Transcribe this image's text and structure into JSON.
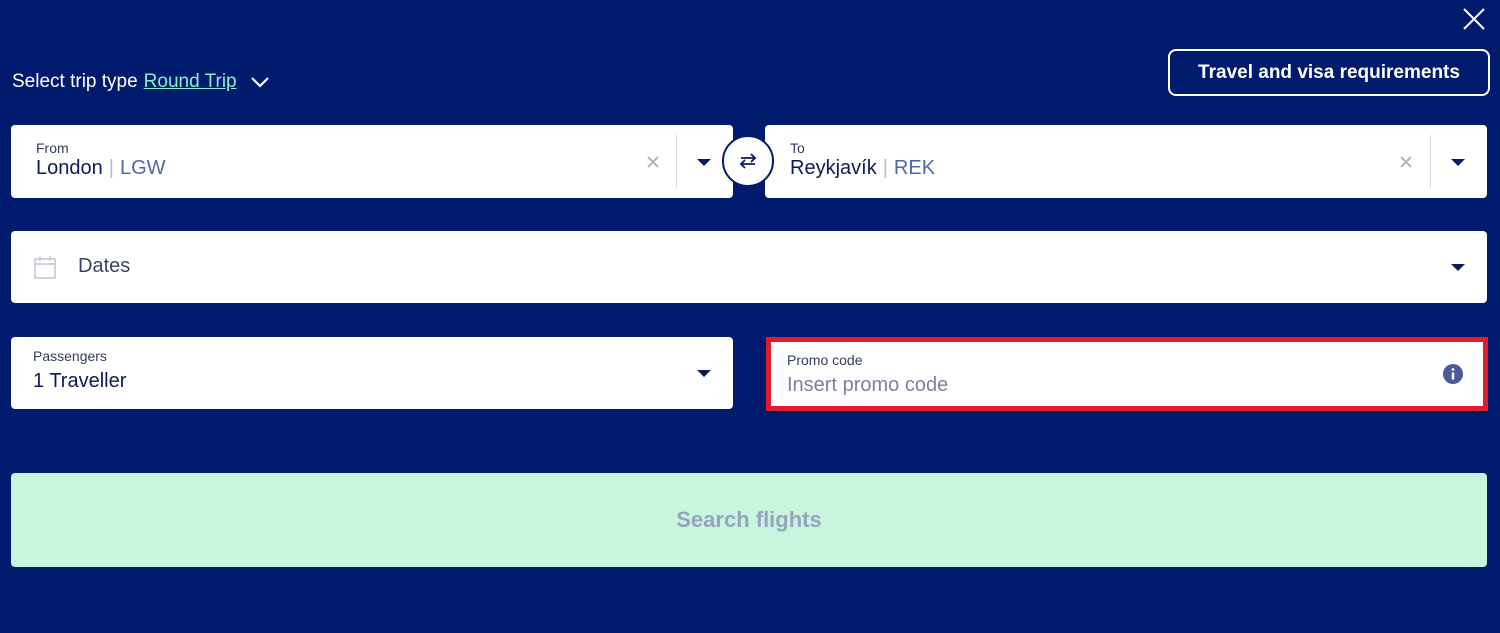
{
  "close_icon": "close-icon",
  "trip_type": {
    "label": "Select trip type",
    "value": "Round Trip"
  },
  "visa_button": {
    "label": "Travel and visa requirements"
  },
  "from": {
    "label": "From",
    "city": "London",
    "code": "LGW"
  },
  "to": {
    "label": "To",
    "city": "Reykjavík",
    "code": "REK"
  },
  "dates": {
    "label": "Dates"
  },
  "passengers": {
    "label": "Passengers",
    "value": "1 Traveller"
  },
  "promo": {
    "label": "Promo code",
    "placeholder": "Insert promo code"
  },
  "search_button": {
    "label": "Search flights"
  },
  "colors": {
    "background": "#001b6e",
    "accent_link": "#86efd0",
    "search_button_bg": "#c8f5dd",
    "highlight_border": "#e11d2b"
  }
}
